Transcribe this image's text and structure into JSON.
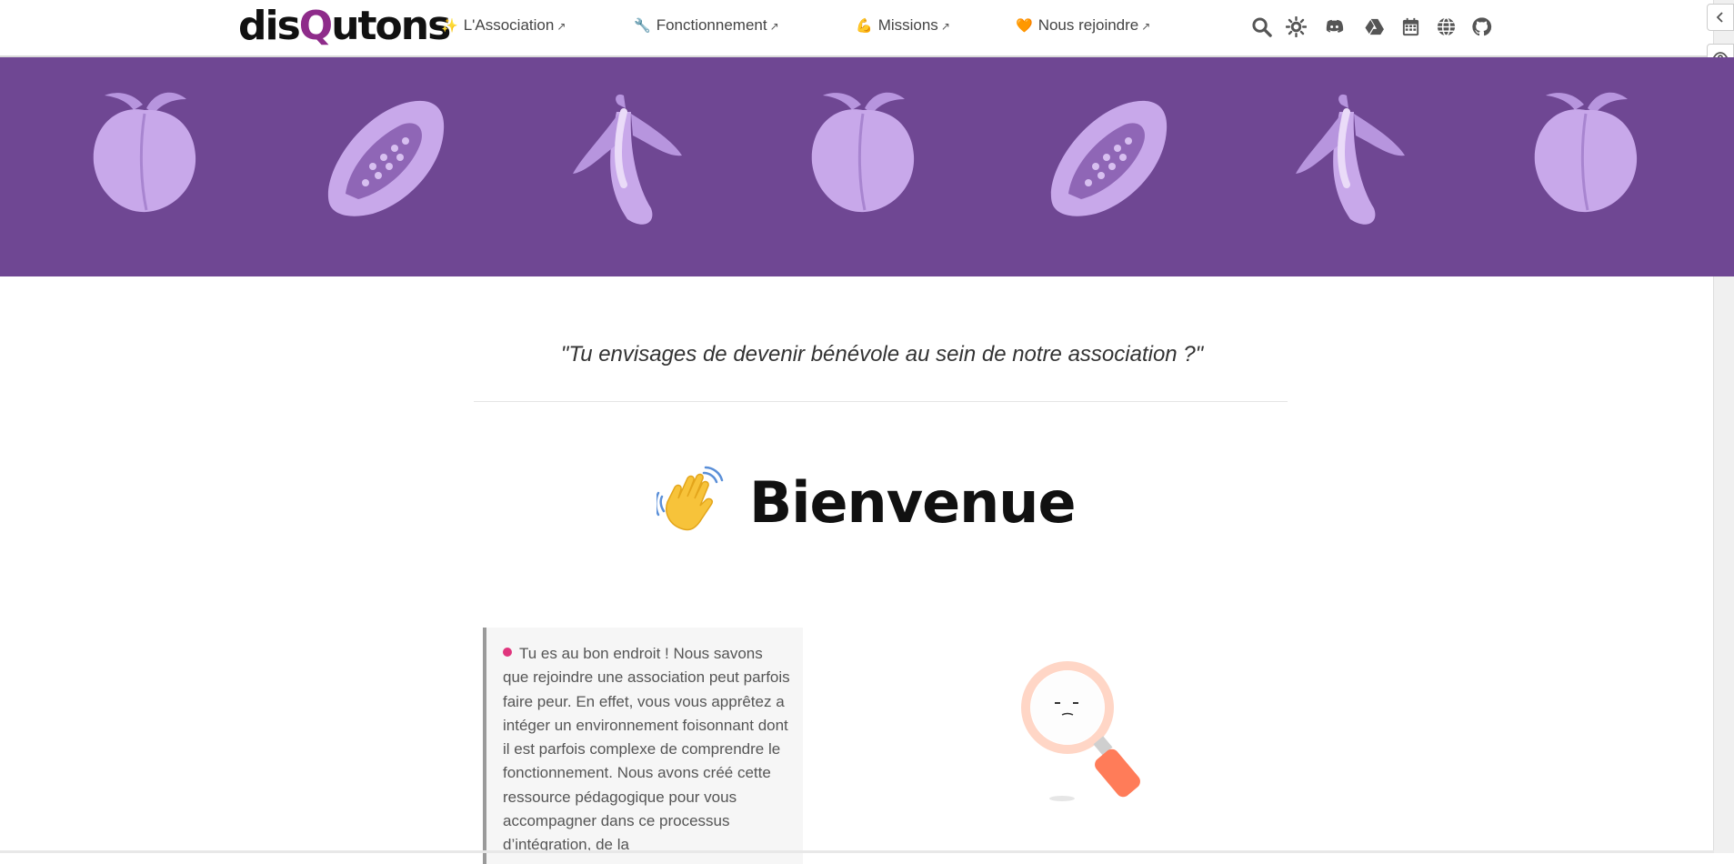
{
  "logo": {
    "part1": "dis",
    "part2": "Q",
    "part3": "utons"
  },
  "nav": {
    "links": [
      {
        "emoji": "✨",
        "label": "L'Association"
      },
      {
        "emoji": "🔧",
        "label": "Fonctionnement"
      },
      {
        "emoji": "💪",
        "label": "Missions"
      },
      {
        "emoji": "🧡",
        "label": "Nous rejoindre"
      }
    ],
    "icons": [
      "search-icon",
      "theme-toggle-icon",
      "discord-icon",
      "google-drive-icon",
      "calendar-icon",
      "globe-icon",
      "github-icon"
    ]
  },
  "banner": {
    "fruits": [
      "peach",
      "papaya",
      "banana",
      "peach",
      "papaya",
      "banana",
      "peach"
    ]
  },
  "content": {
    "quote": "\"Tu envisages de devenir bénévole au sein de notre association ?\"",
    "wave_emoji": "👋",
    "title": "Bienvenue",
    "callout": "Tu es au bon endroit ! Nous savons que rejoindre une association peut parfois faire peur. En effet, vous vous apprêtez a intéger un environnement foisonnant dont il est parfois complexe de comprendre le fonctionnement. Nous avons créé cette ressource pédagogique pour vous accompagner dans ce processus d’intégration, de la"
  },
  "colors": {
    "banner": "#6f4793",
    "fruit": "#c9a7ec",
    "accent": "#8e2b8a"
  }
}
